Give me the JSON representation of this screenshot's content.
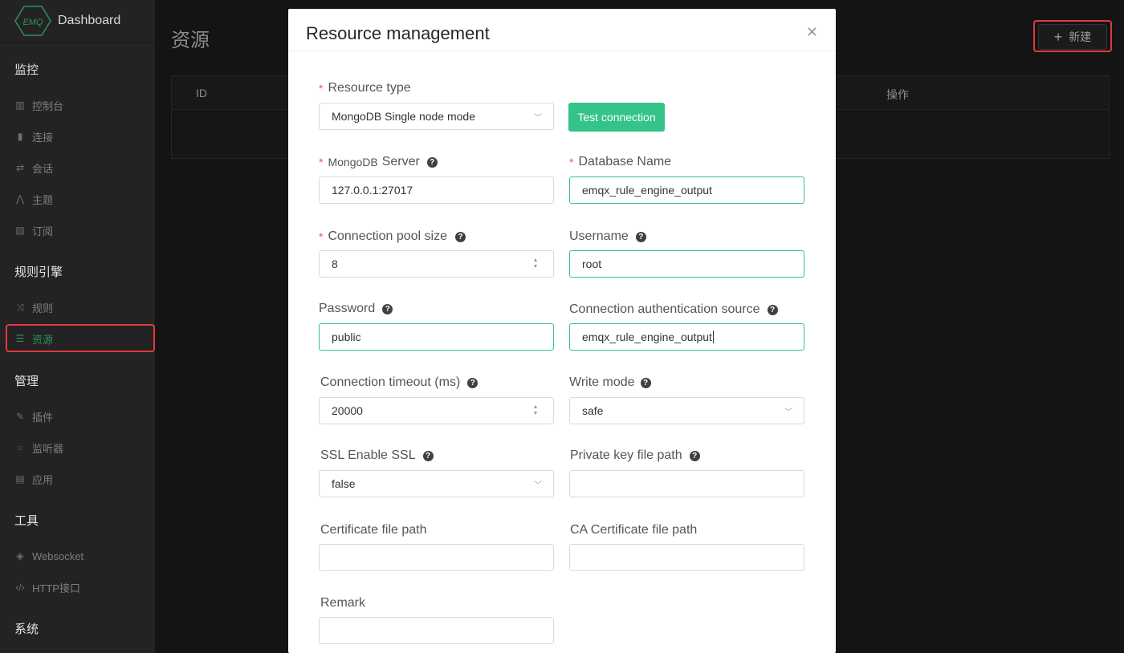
{
  "sidebar": {
    "brand": {
      "logo_text": "EMQ",
      "name": "Dashboard"
    },
    "groups": {
      "monitor": "监控",
      "rule_engine": "规则引擎",
      "manage": "管理",
      "tools": "工具",
      "system": "系统"
    },
    "items": {
      "console": "控制台",
      "connections": "连接",
      "sessions": "会话",
      "topics": "主题",
      "subscriptions": "订阅",
      "rules": "规则",
      "resources": "资源",
      "plugins": "插件",
      "listeners": "监听器",
      "applications": "应用",
      "websocket": "Websocket",
      "http_api": "HTTP接口"
    }
  },
  "main": {
    "title": "资源",
    "new_button": "新建",
    "table": {
      "col_id": "ID",
      "col_actions": "操作"
    }
  },
  "dialog": {
    "title": "Resource management",
    "test_button": "Test connection",
    "fields": {
      "resource_type": {
        "label": "Resource type",
        "value": "MongoDB Single node mode",
        "required": true
      },
      "server": {
        "label_prefix": "MongoDB",
        "label": "Server",
        "value": "127.0.0.1:27017",
        "required": true
      },
      "database_name": {
        "label": "Database Name",
        "value": "emqx_rule_engine_output",
        "required": true
      },
      "pool_size": {
        "label": "Connection pool size",
        "value": "8",
        "required": true
      },
      "username": {
        "label": "Username",
        "value": "root"
      },
      "password": {
        "label": "Password",
        "value": "public"
      },
      "auth_source": {
        "label": "Connection authentication source",
        "value": "emqx_rule_engine_output"
      },
      "timeout": {
        "label": "Connection timeout (ms)",
        "value": "20000"
      },
      "write_mode": {
        "label": "Write mode",
        "value": "safe"
      },
      "ssl": {
        "label": "SSL Enable SSL",
        "value": "false"
      },
      "private_key": {
        "label": "Private key file path",
        "value": ""
      },
      "cert": {
        "label": "Certificate file path",
        "value": ""
      },
      "ca_cert": {
        "label": "CA Certificate file path",
        "value": ""
      },
      "remark": {
        "label": "Remark",
        "value": ""
      }
    }
  },
  "colors": {
    "accent": "#34c388",
    "highlight": "#e03a3e",
    "required": "#f25353"
  }
}
